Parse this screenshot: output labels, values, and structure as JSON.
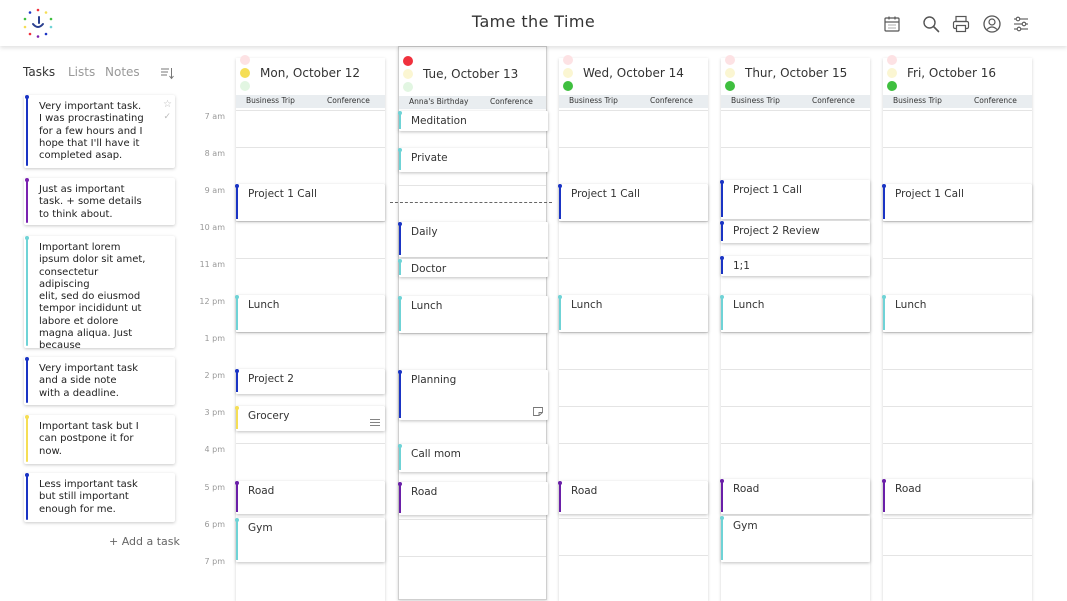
{
  "header": {
    "title": "Tame the Time",
    "icons": [
      "calendar-icon",
      "search-icon",
      "print-icon",
      "account-icon",
      "settings-sliders-icon"
    ]
  },
  "sidebar": {
    "tabs": [
      {
        "label": "Tasks",
        "active": true
      },
      {
        "label": "Lists",
        "active": false
      },
      {
        "label": "Notes",
        "active": false
      }
    ],
    "tasks": [
      {
        "text": "Very important task.\nI was procrastinating\nfor a few hours and I\nhope that I'll have it\ncompleted asap.",
        "color": "#1a34c4"
      },
      {
        "text": "Just as important\ntask. + some details\nto think about.",
        "color": "#7a22b0"
      },
      {
        "text": "Important lorem\nipsum dolor sit amet,\nconsectetur adipiscing\nelit, sed do eiusmod\ntempor incididunt ut\nlabore et dolore\nmagna aliqua. Just\nbecause",
        "color": "#6fd3d6"
      },
      {
        "text": "Very important task\nand a side note\nwith a deadline.",
        "color": "#1a34c4"
      },
      {
        "text": "Important task but I\ncan postpone it for\nnow.",
        "color": "#f5de55"
      },
      {
        "text": "Less important task\nbut still important\nenough for me.",
        "color": "#1a34c4"
      }
    ],
    "add_task_label": "+ Add a task"
  },
  "times": [
    "7 am",
    "8 am",
    "9 am",
    "10 am",
    "11 am",
    "12 pm",
    "1 pm",
    "2 pm",
    "3 pm",
    "4 pm",
    "5 pm",
    "6 pm",
    "7 pm"
  ],
  "colors": {
    "blue": "#1a34c4",
    "teal": "#6fd3d6",
    "purple": "#6a1fa8",
    "yellow": "#f5de55",
    "red": "#f0313d",
    "green": "#3fbf3f"
  },
  "days": [
    {
      "label": "Mon, October 12",
      "today": false,
      "priority": [
        "pale-red",
        "yellow",
        "pale-green"
      ],
      "allday": [
        "Business Trip",
        "Conference"
      ],
      "events": [
        {
          "title": "Project 1 Call",
          "start": 9,
          "end": 10,
          "color": "blue"
        },
        {
          "title": "Lunch",
          "start": 12,
          "end": 13,
          "color": "teal"
        },
        {
          "title": "Project 2",
          "start": 14,
          "end": 14.66,
          "color": "blue"
        },
        {
          "title": "Grocery",
          "start": 15,
          "end": 15.66,
          "color": "yellow",
          "icon": "list-icon"
        },
        {
          "title": "Road",
          "start": 17,
          "end": 17.9,
          "color": "purple"
        },
        {
          "title": "Gym",
          "start": 18,
          "end": 19.2,
          "color": "teal"
        }
      ]
    },
    {
      "label": "Tue, October 13",
      "today": true,
      "priority": [
        "red",
        "pale-yellow",
        "pale-green"
      ],
      "allday": [
        "Anna's Birthday",
        "Conference"
      ],
      "events": [
        {
          "title": "Meditation",
          "start": 7,
          "end": 7.55,
          "color": "teal"
        },
        {
          "title": "Private",
          "start": 8,
          "end": 8.66,
          "color": "teal"
        },
        {
          "title": "Daily",
          "start": 10,
          "end": 10.95,
          "color": "blue"
        },
        {
          "title": "Doctor",
          "start": 11,
          "end": 11.5,
          "color": "teal"
        },
        {
          "title": "Lunch",
          "start": 12,
          "end": 13,
          "color": "teal"
        },
        {
          "title": "Planning",
          "start": 14,
          "end": 15.33,
          "color": "blue",
          "icon": "note-icon"
        },
        {
          "title": "Call mom",
          "start": 16,
          "end": 16.75,
          "color": "teal"
        },
        {
          "title": "Road",
          "start": 17,
          "end": 17.9,
          "color": "purple"
        }
      ]
    },
    {
      "label": "Wed, October 14",
      "today": false,
      "priority": [
        "pale-red",
        "pale-yellow",
        "green"
      ],
      "allday": [
        "Business Trip",
        "Conference"
      ],
      "events": [
        {
          "title": "Project 1 Call",
          "start": 9,
          "end": 10,
          "color": "blue"
        },
        {
          "title": "Lunch",
          "start": 12,
          "end": 13,
          "color": "teal"
        },
        {
          "title": "Road",
          "start": 17,
          "end": 17.9,
          "color": "purple"
        }
      ]
    },
    {
      "label": "Thur, October 15",
      "today": false,
      "priority": [
        "pale-red",
        "pale-yellow",
        "green"
      ],
      "allday": [
        "Business Trip",
        "Conference"
      ],
      "events": [
        {
          "title": "Project 1 Call",
          "start": 8.9,
          "end": 9.95,
          "color": "blue"
        },
        {
          "title": "Project 2 Review",
          "start": 10,
          "end": 10.6,
          "color": "blue"
        },
        {
          "title": "1;1",
          "start": 10.95,
          "end": 11.5,
          "color": "blue"
        },
        {
          "title": "Lunch",
          "start": 12,
          "end": 13,
          "color": "teal"
        },
        {
          "title": "Road",
          "start": 16.95,
          "end": 17.9,
          "color": "purple"
        },
        {
          "title": "Gym",
          "start": 17.95,
          "end": 19.2,
          "color": "teal"
        }
      ]
    },
    {
      "label": "Fri, October 16",
      "today": false,
      "priority": [
        "pale-red",
        "pale-yellow",
        "green"
      ],
      "allday": [
        "Business Trip",
        "Conference"
      ],
      "events": [
        {
          "title": "Project 1 Call",
          "start": 9,
          "end": 10,
          "color": "blue"
        },
        {
          "title": "Lunch",
          "start": 12,
          "end": 13,
          "color": "teal"
        },
        {
          "title": "Road",
          "start": 16.95,
          "end": 17.9,
          "color": "purple"
        }
      ]
    }
  ]
}
